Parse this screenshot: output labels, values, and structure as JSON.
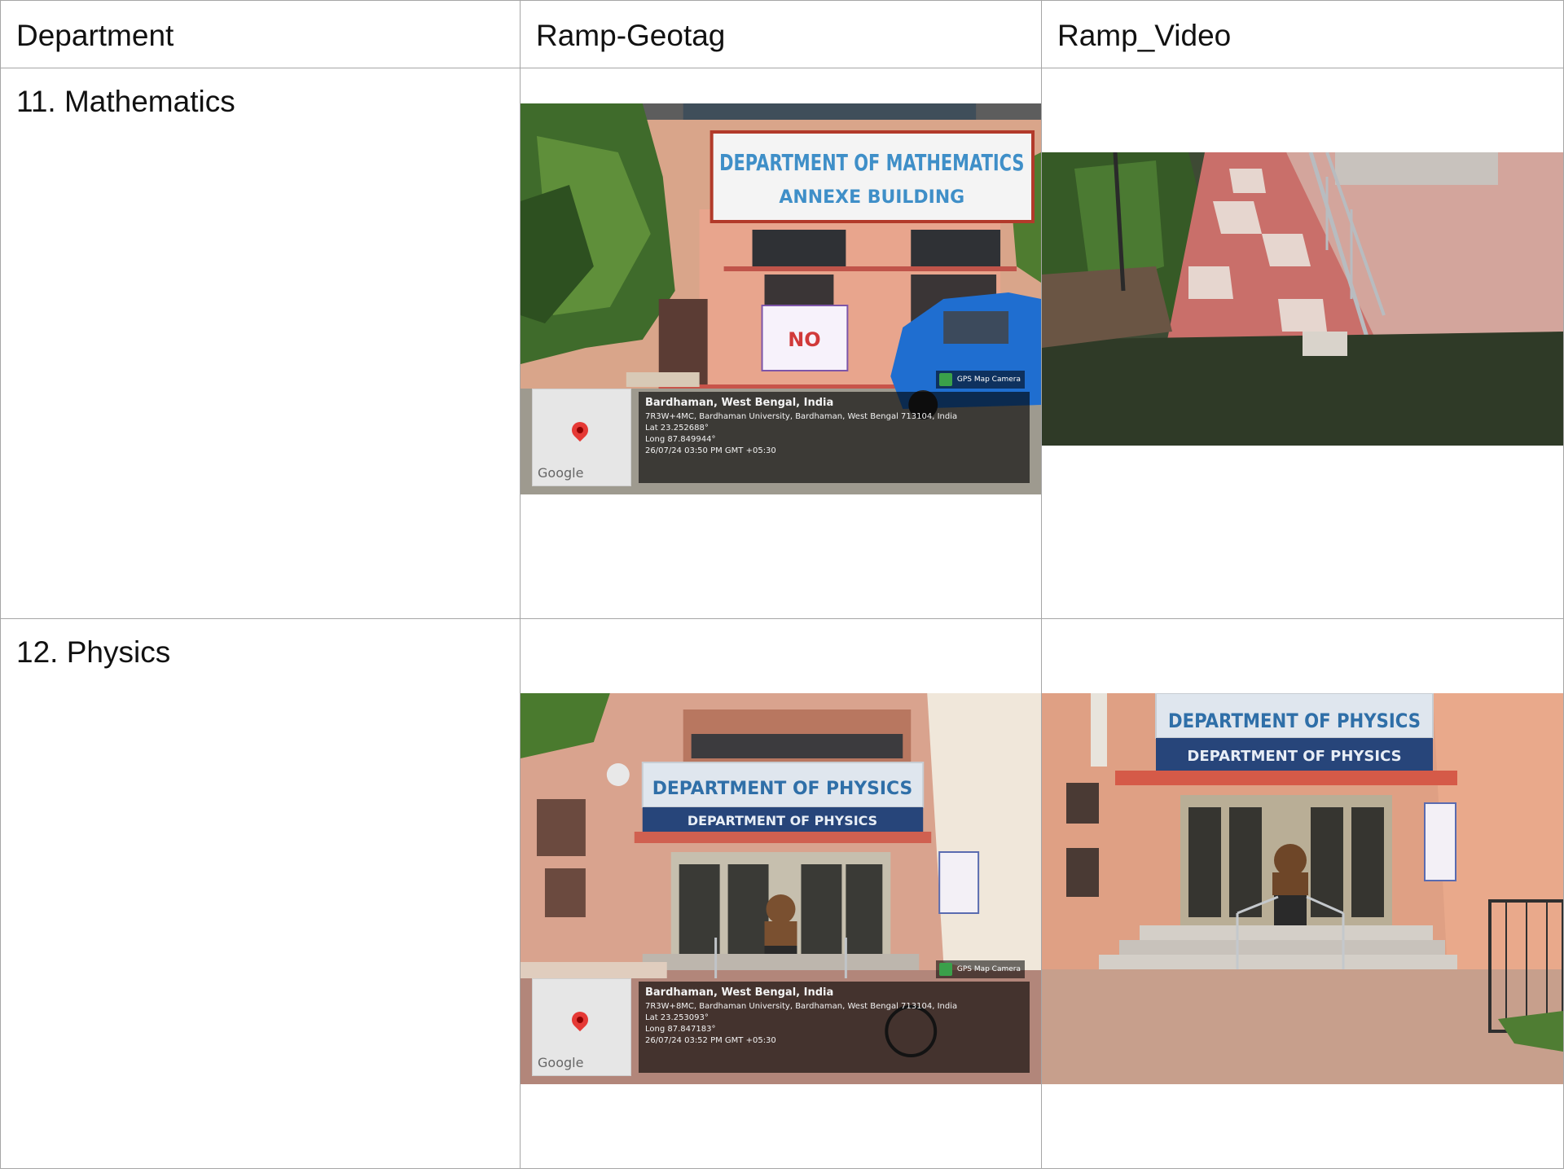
{
  "table": {
    "headers": [
      "Department",
      "Ramp-Geotag",
      "Ramp_Video"
    ],
    "rows": [
      {
        "department": "11. Mathematics",
        "geotag": {
          "sign_line1": "DEPARTMENT OF MATHEMATICS",
          "sign_line2": "ANNEXE BUILDING",
          "notice_text": "NO",
          "badge": "GPS Map Camera",
          "map_brand": "Google",
          "location": "Bardhaman, West Bengal, India",
          "address": "7R3W+4MC, Bardhaman University, Bardhaman, West Bengal 713104, India",
          "lat": "Lat 23.252688°",
          "long": "Long 87.849944°",
          "timestamp": "26/07/24 03:50 PM GMT +05:30"
        }
      },
      {
        "department": "12. Physics",
        "geotag": {
          "sign_line1": "DEPARTMENT OF PHYSICS",
          "sign_line2": "DEPARTMENT OF PHYSICS",
          "badge": "GPS Map Camera",
          "map_brand": "Google",
          "location": "Bardhaman, West Bengal, India",
          "address": "7R3W+8MC, Bardhaman University, Bardhaman, West Bengal 713104, India",
          "lat": "Lat 23.253093°",
          "long": "Long 87.847183°",
          "timestamp": "26/07/24 03:52 PM GMT +05:30"
        },
        "video": {
          "sign_line1": "DEPARTMENT OF PHYSICS",
          "sign_line2": "DEPARTMENT OF PHYSICS"
        }
      }
    ]
  }
}
